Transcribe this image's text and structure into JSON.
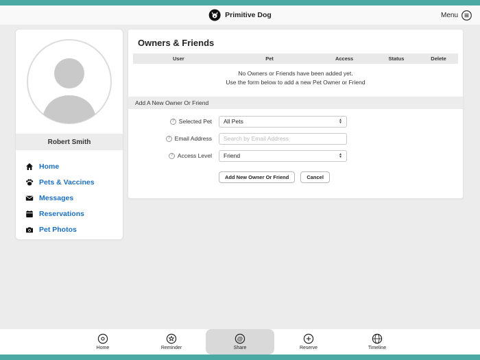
{
  "header": {
    "app_name": "Primitive Dog",
    "menu_label": "Menu"
  },
  "sidebar": {
    "user_name": "Robert Smith",
    "items": [
      {
        "label": "Home",
        "icon": "home-icon"
      },
      {
        "label": "Pets & Vaccines",
        "icon": "paw-icon"
      },
      {
        "label": "Messages",
        "icon": "envelope-icon"
      },
      {
        "label": "Reservations",
        "icon": "calendar-icon"
      },
      {
        "label": "Pet Photos",
        "icon": "camera-icon"
      }
    ]
  },
  "main": {
    "title": "Owners & Friends",
    "table": {
      "columns": [
        "User",
        "Pet",
        "Access",
        "Status",
        "Delete"
      ],
      "empty_line1": "No Owners or Friends have been added yet.",
      "empty_line2": "Use the form below to add a new Pet Owner or Friend"
    },
    "form": {
      "section_title": "Add A New Owner Or Friend",
      "selected_pet_label": "Selected Pet",
      "selected_pet_value": "All Pets",
      "email_label": "Email Address",
      "email_placeholder": "Search by Email Address",
      "access_label": "Access Level",
      "access_value": "Friend",
      "submit_label": "Add New Owner Or Friend",
      "cancel_label": "Cancel"
    }
  },
  "tabbar": {
    "items": [
      {
        "label": "Home",
        "icon": "record-icon"
      },
      {
        "label": "Reminder",
        "icon": "star-icon"
      },
      {
        "label": "Share",
        "icon": "at-icon"
      },
      {
        "label": "Reserve",
        "icon": "plus-icon"
      },
      {
        "label": "Timeline",
        "icon": "globe-icon"
      }
    ]
  },
  "colors": {
    "accent_teal": "#4BA9A4",
    "link_blue": "#1b6fc0"
  }
}
